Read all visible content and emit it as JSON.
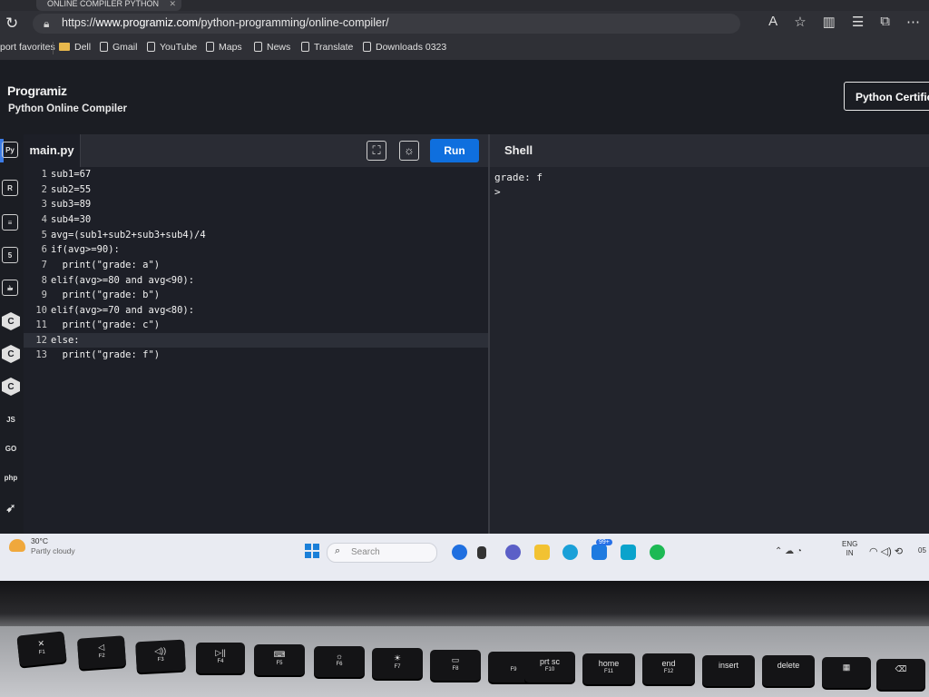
{
  "browser": {
    "tab_title": "ONLINE COMPILER PYTHON",
    "url_prefix": "https://",
    "url_domain": "www.programiz.com",
    "url_path": "/python-programming/online-compiler/",
    "favorites": [
      {
        "label": "port favorites",
        "icon": "none"
      },
      {
        "label": "Dell",
        "icon": "folder-icon"
      },
      {
        "label": "Gmail",
        "icon": "page-icon"
      },
      {
        "label": "YouTube",
        "icon": "page-icon"
      },
      {
        "label": "Maps",
        "icon": "page-icon"
      },
      {
        "label": "News",
        "icon": "page-icon"
      },
      {
        "label": "Translate",
        "icon": "page-icon"
      },
      {
        "label": "Downloads 0323",
        "icon": "page-icon"
      }
    ]
  },
  "header": {
    "logo": "Programiz",
    "subtitle": "Python Online Compiler",
    "cert_button": "Python Certification"
  },
  "sidebar": {
    "languages": [
      "python-icon",
      "r-icon",
      "sql-icon",
      "html-icon",
      "java-icon",
      "c-icon",
      "cpp-icon",
      "csharp-icon",
      "JS",
      "GO",
      "php",
      "swift-icon"
    ]
  },
  "editor": {
    "file_tab": "main.py",
    "run_label": "Run",
    "lines": [
      {
        "n": "1",
        "code": "sub1=67"
      },
      {
        "n": "2",
        "code": "sub2=55"
      },
      {
        "n": "3",
        "code": "sub3=89"
      },
      {
        "n": "4",
        "code": "sub4=30"
      },
      {
        "n": "5",
        "code": "avg=(sub1+sub2+sub3+sub4)/4"
      },
      {
        "n": "6",
        "code": "if(avg>=90):"
      },
      {
        "n": "7",
        "code": "  print(\"grade: a\")"
      },
      {
        "n": "8",
        "code": "elif(avg>=80 and avg<90):"
      },
      {
        "n": "9",
        "code": "  print(\"grade: b\")"
      },
      {
        "n": "10",
        "code": "elif(avg>=70 and avg<80):"
      },
      {
        "n": "11",
        "code": "  print(\"grade: c\")"
      },
      {
        "n": "12",
        "code": "else:"
      },
      {
        "n": "13",
        "code": "  print(\"grade: f\")"
      }
    ]
  },
  "shell": {
    "title": "Shell",
    "output": "grade: f\n>"
  },
  "taskbar": {
    "temperature": "30°C",
    "condition": "Partly cloudy",
    "search_placeholder": "Search",
    "badge": "99+",
    "lang_top": "ENG",
    "lang_bottom": "IN",
    "clock": "05"
  },
  "keyboard": {
    "keys": [
      {
        "main": "F1",
        "sub": ""
      },
      {
        "main": "F2",
        "sub": ""
      },
      {
        "main": "F3",
        "sub": ""
      },
      {
        "main": "F4",
        "sub": ""
      },
      {
        "main": "F5",
        "sub": ""
      },
      {
        "main": "F6",
        "sub": ""
      },
      {
        "main": "F7",
        "sub": ""
      },
      {
        "main": "F8",
        "sub": ""
      },
      {
        "main": "F9",
        "sub": ""
      },
      {
        "main": "prt sc",
        "sub": "F10"
      },
      {
        "main": "home",
        "sub": "F11"
      },
      {
        "main": "end",
        "sub": "F12"
      },
      {
        "main": "insert",
        "sub": ""
      },
      {
        "main": "delete",
        "sub": ""
      }
    ]
  }
}
